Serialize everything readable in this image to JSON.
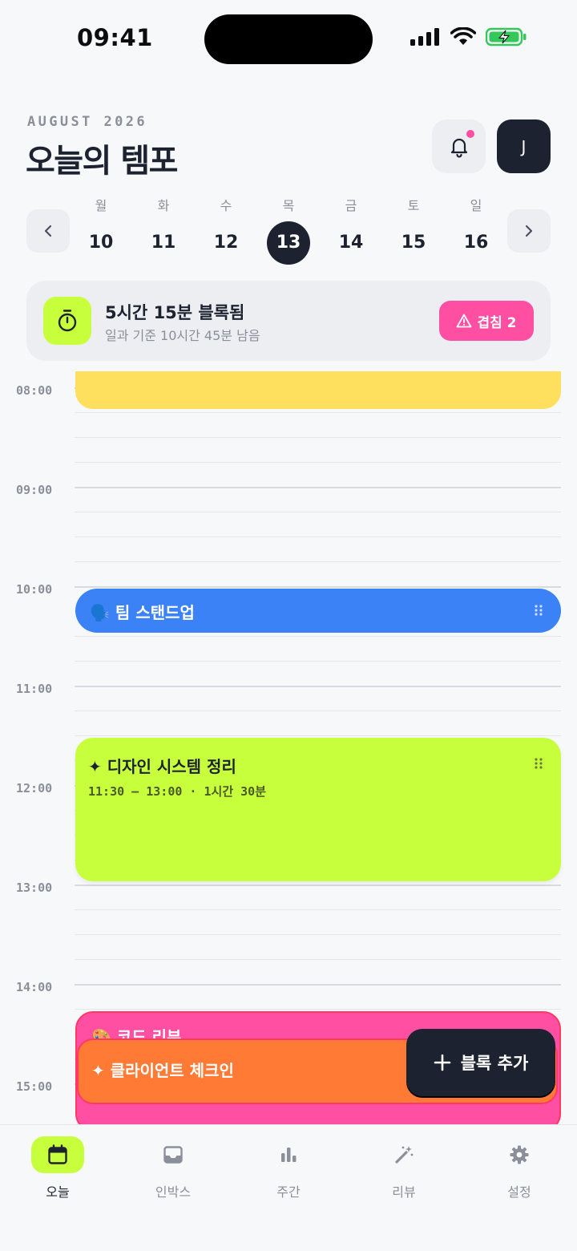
{
  "status_bar": {
    "time": "09:41"
  },
  "header": {
    "month_label": "AUGUST 2026",
    "title": "오늘의 템포",
    "avatar_initial": "J"
  },
  "week": {
    "days": [
      {
        "name": "월",
        "num": "10"
      },
      {
        "name": "화",
        "num": "11"
      },
      {
        "name": "수",
        "num": "12"
      },
      {
        "name": "목",
        "num": "13"
      },
      {
        "name": "금",
        "num": "14"
      },
      {
        "name": "토",
        "num": "15"
      },
      {
        "name": "일",
        "num": "16"
      }
    ],
    "selected_index": 3
  },
  "summary": {
    "title": "5시간 15분 블록됨",
    "subtitle": "일과 기준 10시간 45분 남음",
    "overlap_label": "겹침 2"
  },
  "timeline": {
    "hours": [
      "08:00",
      "09:00",
      "10:00",
      "11:00",
      "12:00",
      "13:00",
      "14:00",
      "15:00"
    ],
    "blocks": {
      "standup": {
        "emoji": "🗣️",
        "title": "팀 스탠드업"
      },
      "design": {
        "title": "✦ 디자인 시스템 정리",
        "meta": "11:30 – 13:00 · 1시간 30분"
      },
      "pink": {
        "title": "🎨 코드 리뷰"
      },
      "client": {
        "title": "✦ 클라이언트 체크인"
      }
    }
  },
  "fab": {
    "label": "블록 추가"
  },
  "tabbar": {
    "tabs": [
      {
        "label": "오늘",
        "icon": "calendar-icon"
      },
      {
        "label": "인박스",
        "icon": "inbox-icon"
      },
      {
        "label": "주간",
        "icon": "bar-chart-icon"
      },
      {
        "label": "리뷰",
        "icon": "magic-wand-icon"
      },
      {
        "label": "설정",
        "icon": "gear-icon"
      }
    ],
    "active_index": 0
  },
  "colors": {
    "accent_lime": "#c8ff3d",
    "dark": "#1d2230",
    "pink": "#ff4fa3",
    "blue": "#3b82f6",
    "yellow": "#ffdf5d",
    "orange": "#ff7a35"
  }
}
